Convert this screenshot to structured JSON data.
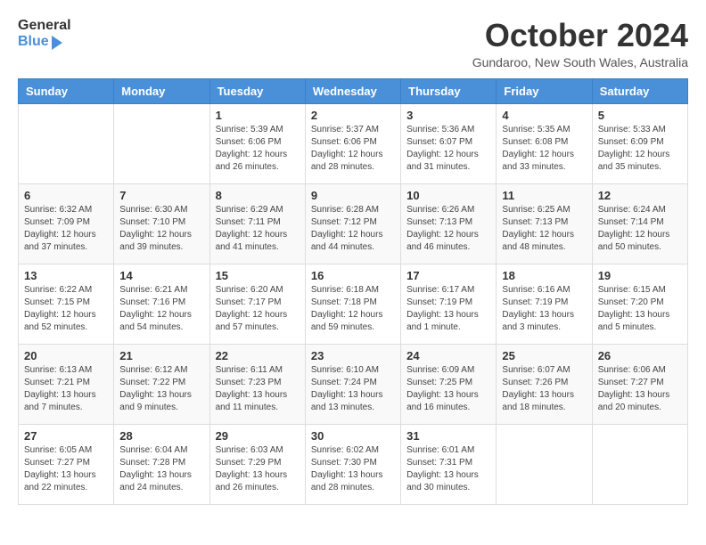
{
  "header": {
    "logo_general": "General",
    "logo_blue": "Blue",
    "month_year": "October 2024",
    "location": "Gundaroo, New South Wales, Australia"
  },
  "days_of_week": [
    "Sunday",
    "Monday",
    "Tuesday",
    "Wednesday",
    "Thursday",
    "Friday",
    "Saturday"
  ],
  "weeks": [
    [
      {
        "day": "",
        "info": ""
      },
      {
        "day": "",
        "info": ""
      },
      {
        "day": "1",
        "info": "Sunrise: 5:39 AM\nSunset: 6:06 PM\nDaylight: 12 hours and 26 minutes."
      },
      {
        "day": "2",
        "info": "Sunrise: 5:37 AM\nSunset: 6:06 PM\nDaylight: 12 hours and 28 minutes."
      },
      {
        "day": "3",
        "info": "Sunrise: 5:36 AM\nSunset: 6:07 PM\nDaylight: 12 hours and 31 minutes."
      },
      {
        "day": "4",
        "info": "Sunrise: 5:35 AM\nSunset: 6:08 PM\nDaylight: 12 hours and 33 minutes."
      },
      {
        "day": "5",
        "info": "Sunrise: 5:33 AM\nSunset: 6:09 PM\nDaylight: 12 hours and 35 minutes."
      }
    ],
    [
      {
        "day": "6",
        "info": "Sunrise: 6:32 AM\nSunset: 7:09 PM\nDaylight: 12 hours and 37 minutes."
      },
      {
        "day": "7",
        "info": "Sunrise: 6:30 AM\nSunset: 7:10 PM\nDaylight: 12 hours and 39 minutes."
      },
      {
        "day": "8",
        "info": "Sunrise: 6:29 AM\nSunset: 7:11 PM\nDaylight: 12 hours and 41 minutes."
      },
      {
        "day": "9",
        "info": "Sunrise: 6:28 AM\nSunset: 7:12 PM\nDaylight: 12 hours and 44 minutes."
      },
      {
        "day": "10",
        "info": "Sunrise: 6:26 AM\nSunset: 7:13 PM\nDaylight: 12 hours and 46 minutes."
      },
      {
        "day": "11",
        "info": "Sunrise: 6:25 AM\nSunset: 7:13 PM\nDaylight: 12 hours and 48 minutes."
      },
      {
        "day": "12",
        "info": "Sunrise: 6:24 AM\nSunset: 7:14 PM\nDaylight: 12 hours and 50 minutes."
      }
    ],
    [
      {
        "day": "13",
        "info": "Sunrise: 6:22 AM\nSunset: 7:15 PM\nDaylight: 12 hours and 52 minutes."
      },
      {
        "day": "14",
        "info": "Sunrise: 6:21 AM\nSunset: 7:16 PM\nDaylight: 12 hours and 54 minutes."
      },
      {
        "day": "15",
        "info": "Sunrise: 6:20 AM\nSunset: 7:17 PM\nDaylight: 12 hours and 57 minutes."
      },
      {
        "day": "16",
        "info": "Sunrise: 6:18 AM\nSunset: 7:18 PM\nDaylight: 12 hours and 59 minutes."
      },
      {
        "day": "17",
        "info": "Sunrise: 6:17 AM\nSunset: 7:19 PM\nDaylight: 13 hours and 1 minute."
      },
      {
        "day": "18",
        "info": "Sunrise: 6:16 AM\nSunset: 7:19 PM\nDaylight: 13 hours and 3 minutes."
      },
      {
        "day": "19",
        "info": "Sunrise: 6:15 AM\nSunset: 7:20 PM\nDaylight: 13 hours and 5 minutes."
      }
    ],
    [
      {
        "day": "20",
        "info": "Sunrise: 6:13 AM\nSunset: 7:21 PM\nDaylight: 13 hours and 7 minutes."
      },
      {
        "day": "21",
        "info": "Sunrise: 6:12 AM\nSunset: 7:22 PM\nDaylight: 13 hours and 9 minutes."
      },
      {
        "day": "22",
        "info": "Sunrise: 6:11 AM\nSunset: 7:23 PM\nDaylight: 13 hours and 11 minutes."
      },
      {
        "day": "23",
        "info": "Sunrise: 6:10 AM\nSunset: 7:24 PM\nDaylight: 13 hours and 13 minutes."
      },
      {
        "day": "24",
        "info": "Sunrise: 6:09 AM\nSunset: 7:25 PM\nDaylight: 13 hours and 16 minutes."
      },
      {
        "day": "25",
        "info": "Sunrise: 6:07 AM\nSunset: 7:26 PM\nDaylight: 13 hours and 18 minutes."
      },
      {
        "day": "26",
        "info": "Sunrise: 6:06 AM\nSunset: 7:27 PM\nDaylight: 13 hours and 20 minutes."
      }
    ],
    [
      {
        "day": "27",
        "info": "Sunrise: 6:05 AM\nSunset: 7:27 PM\nDaylight: 13 hours and 22 minutes."
      },
      {
        "day": "28",
        "info": "Sunrise: 6:04 AM\nSunset: 7:28 PM\nDaylight: 13 hours and 24 minutes."
      },
      {
        "day": "29",
        "info": "Sunrise: 6:03 AM\nSunset: 7:29 PM\nDaylight: 13 hours and 26 minutes."
      },
      {
        "day": "30",
        "info": "Sunrise: 6:02 AM\nSunset: 7:30 PM\nDaylight: 13 hours and 28 minutes."
      },
      {
        "day": "31",
        "info": "Sunrise: 6:01 AM\nSunset: 7:31 PM\nDaylight: 13 hours and 30 minutes."
      },
      {
        "day": "",
        "info": ""
      },
      {
        "day": "",
        "info": ""
      }
    ]
  ]
}
